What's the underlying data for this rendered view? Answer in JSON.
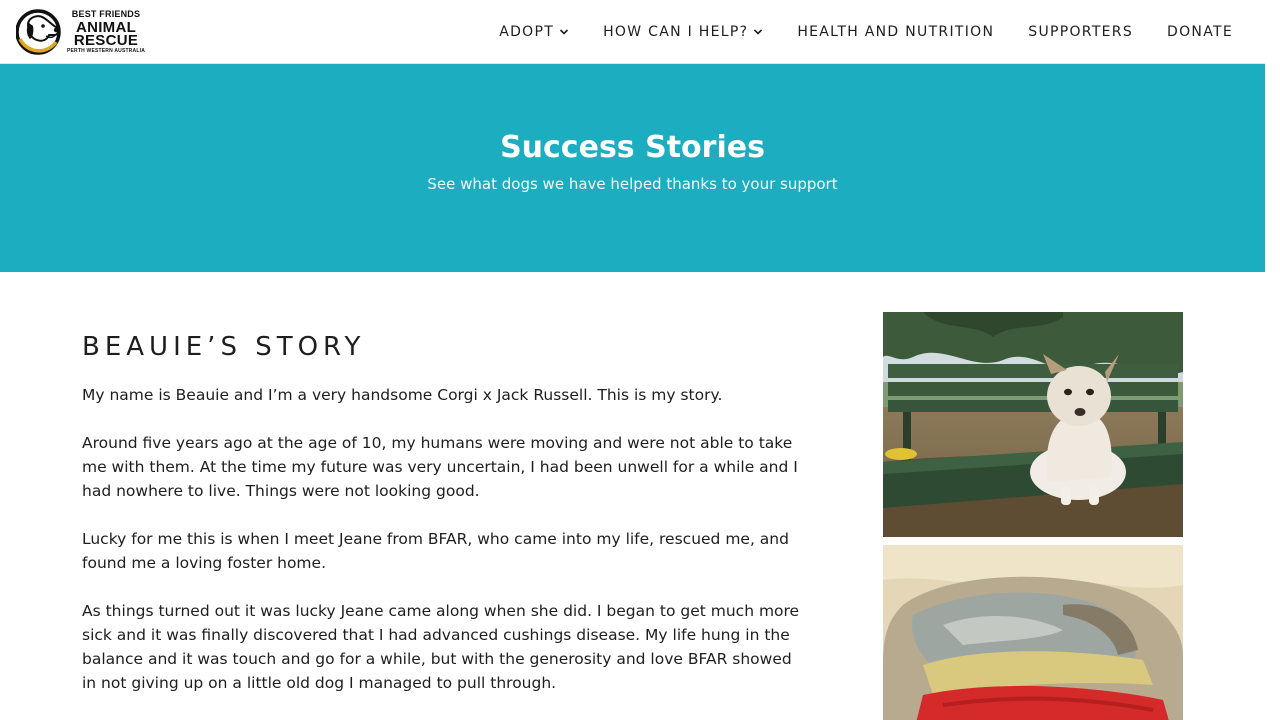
{
  "logo": {
    "line1": "BEST FRIENDS",
    "line2": "ANIMAL",
    "line3": "RESCUE",
    "line4": "PERTH WESTERN AUSTRALIA"
  },
  "nav": {
    "items": [
      {
        "label": "ADOPT",
        "has_dropdown": true
      },
      {
        "label": "HOW CAN I HELP?",
        "has_dropdown": true
      },
      {
        "label": "HEALTH AND NUTRITION",
        "has_dropdown": false
      },
      {
        "label": "SUPPORTERS",
        "has_dropdown": false
      },
      {
        "label": "DONATE",
        "has_dropdown": false
      }
    ]
  },
  "hero": {
    "title": "Success Stories",
    "subtitle": "See what dogs we have helped thanks to your support"
  },
  "story": {
    "title": "BEAUIE’S STORY",
    "paragraphs": [
      "My name is Beauie and I’m a very handsome Corgi x Jack Russell. This is my story.",
      "Around five years ago at the age of 10, my humans were moving and were not able to take me with them. At the time my future was very uncertain, I had been unwell for a while and I had nowhere to live. Things were not looking good.",
      "Lucky for me this is when I meet Jeane from BFAR, who came into my life, rescued me, and found me a loving foster home.",
      "As things turned out it was lucky Jeane came along when she did. I began to get much more sick and it was finally discovered that I had advanced cushings disease. My life hung in the balance and it was touch and go for a while, but with the generosity and love BFAR showed in not giving up on a little old dog I managed to pull through."
    ]
  },
  "colors": {
    "hero_bg": "#1cadc0",
    "text": "#1e1e1e",
    "header_bg": "#ffffff"
  },
  "icons": {
    "nav_dropdown": "chevron-down-icon",
    "logo_mark": "dog-head-icon"
  }
}
